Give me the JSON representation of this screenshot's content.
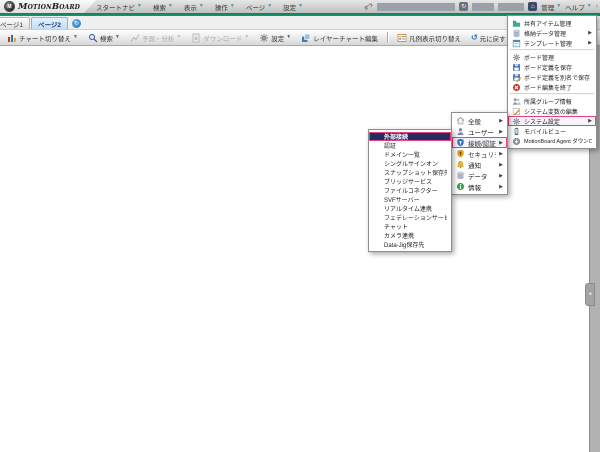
{
  "app": {
    "name": "MotionBoard"
  },
  "menubar": {
    "items": [
      "スタートナビ",
      "検索",
      "表示",
      "操作",
      "ページ",
      "設定"
    ]
  },
  "header": {
    "admin": "管理",
    "help": "ヘルプ"
  },
  "tabs": {
    "page1": "ページ1",
    "page2": "ページ2"
  },
  "toolbar": {
    "chart_switch": "チャート切り替え",
    "search": "検索",
    "forecast": "予測・分析",
    "download": "ダウンロード",
    "settings": "設定",
    "layer_edit": "レイヤーチャート編集",
    "legend_toggle": "凡例表示切り替え",
    "undo": "元に戻す"
  },
  "board_menu": {
    "items": [
      {
        "label": "共有アイテム管理",
        "icon": "shared-items-icon",
        "submenu": false
      },
      {
        "label": "格納データ管理",
        "icon": "stored-data-icon",
        "submenu": true
      },
      {
        "label": "テンプレート管理",
        "icon": "template-icon",
        "submenu": true
      },
      {
        "label": "ボード管理",
        "icon": "board-manage-gear-icon",
        "submenu": false
      },
      {
        "label": "ボード定義を保存",
        "icon": "save-icon",
        "submenu": false
      },
      {
        "label": "ボード定義を別名で保存",
        "icon": "save-as-icon",
        "submenu": false
      },
      {
        "label": "ボード編集を終了",
        "icon": "close-edit-icon",
        "submenu": false
      },
      {
        "label": "所属グループ情報",
        "icon": "group-info-icon",
        "submenu": false
      },
      {
        "label": "システム変数の編集",
        "icon": "edit-variables-icon",
        "submenu": false
      },
      {
        "label": "システム設定",
        "icon": "system-settings-gear-icon",
        "submenu": true,
        "highlighted": true
      },
      {
        "label": "モバイルビュー",
        "icon": "mobile-view-icon",
        "submenu": false
      },
      {
        "label": "MotionBoard Agent ダウンロード",
        "icon": "agent-download-icon",
        "submenu": false
      }
    ]
  },
  "system_menu": {
    "items": [
      {
        "label": "全般",
        "icon": "home-icon"
      },
      {
        "label": "ユーザー",
        "icon": "user-icon"
      },
      {
        "label": "接続/認証",
        "icon": "connection-shield-icon",
        "highlighted": true
      },
      {
        "label": "セキュリティ",
        "icon": "security-shield-icon"
      },
      {
        "label": "通知",
        "icon": "notification-bell-icon"
      },
      {
        "label": "データ",
        "icon": "database-icon"
      },
      {
        "label": "情報",
        "icon": "info-icon"
      }
    ]
  },
  "connection_menu": {
    "items": [
      "外部接続",
      "認証",
      "ドメイン一覧",
      "シングルサインオン",
      "スナップショット保存先",
      "ブリッジサービス",
      "ファイルコネクター",
      "SVFサーバー",
      "リアルタイム連携",
      "フェデレーションサービス",
      "チャット",
      "カメラ連携",
      "Data-Jig保存先"
    ],
    "selected": "外部接続"
  },
  "colors": {
    "accent_green": "#00a06a",
    "highlight_pink": "#e8417d",
    "selected_navy": "#232e63",
    "active_tab_blue": "#c5ddf5"
  },
  "icons": [
    "logo-orb-icon",
    "dropdown-caret-icon",
    "link-icon",
    "refresh-icon",
    "home-button-icon",
    "forward-arrow-icon",
    "page-refresh-icon",
    "chart-switch-icon",
    "search-icon",
    "forecast-analysis-icon",
    "download-icon",
    "settings-gear-icon",
    "layer-chart-icon",
    "legend-toggle-icon",
    "undo-icon",
    "submenu-arrow-icon",
    "panel-collapse-icon"
  ]
}
